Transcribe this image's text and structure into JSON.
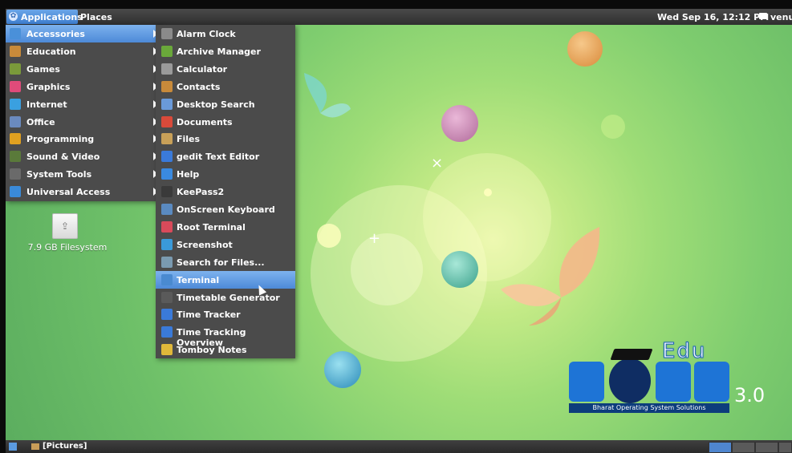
{
  "top_panel": {
    "applications_label": "Applications",
    "places_label": "Places",
    "clock": "Wed Sep 16, 12:12 PM",
    "user": "venu"
  },
  "categories": [
    {
      "label": "Accessories",
      "icon": "accessories-icon",
      "color": "#4a90d9",
      "selected": true
    },
    {
      "label": "Education",
      "icon": "education-icon",
      "color": "#c88a3a"
    },
    {
      "label": "Games",
      "icon": "games-icon",
      "color": "#7a9a3a"
    },
    {
      "label": "Graphics",
      "icon": "graphics-icon",
      "color": "#e04b7a"
    },
    {
      "label": "Internet",
      "icon": "internet-icon",
      "color": "#3aa0e0"
    },
    {
      "label": "Office",
      "icon": "office-icon",
      "color": "#6a8abf"
    },
    {
      "label": "Programming",
      "icon": "programming-icon",
      "color": "#e0a020"
    },
    {
      "label": "Sound & Video",
      "icon": "sound-video-icon",
      "color": "#5a7a3a"
    },
    {
      "label": "System Tools",
      "icon": "system-tools-icon",
      "color": "#6a6a6a"
    },
    {
      "label": "Universal Access",
      "icon": "universal-access-icon",
      "color": "#3a8ad9"
    }
  ],
  "accessories": [
    {
      "label": "Alarm Clock",
      "icon": "alarm-clock-icon",
      "color": "#8a8a8a"
    },
    {
      "label": "Archive Manager",
      "icon": "archive-manager-icon",
      "color": "#6aa83a"
    },
    {
      "label": "Calculator",
      "icon": "calculator-icon",
      "color": "#9a9a9a"
    },
    {
      "label": "Contacts",
      "icon": "contacts-icon",
      "color": "#c88a3a"
    },
    {
      "label": "Desktop Search",
      "icon": "desktop-search-icon",
      "color": "#6a9ad9"
    },
    {
      "label": "Documents",
      "icon": "documents-icon",
      "color": "#d94a3a"
    },
    {
      "label": "Files",
      "icon": "files-icon",
      "color": "#c8a058"
    },
    {
      "label": "gedit Text Editor",
      "icon": "gedit-icon",
      "color": "#3a7ad9"
    },
    {
      "label": "Help",
      "icon": "help-icon",
      "color": "#3a8ae0"
    },
    {
      "label": "KeePass2",
      "icon": "keepass-icon",
      "color": "#3a3a3a"
    },
    {
      "label": "OnScreen Keyboard",
      "icon": "onscreen-keyboard-icon",
      "color": "#5a8ac0"
    },
    {
      "label": "Root Terminal",
      "icon": "root-terminal-icon",
      "color": "#d94a5a"
    },
    {
      "label": "Screenshot",
      "icon": "screenshot-icon",
      "color": "#3a9ad9"
    },
    {
      "label": "Search for Files...",
      "icon": "search-files-icon",
      "color": "#7a9ab0"
    },
    {
      "label": "Terminal",
      "icon": "terminal-icon",
      "color": "#4a8ad0",
      "selected": true
    },
    {
      "label": "Timetable Generator",
      "icon": "timetable-generator-icon",
      "color": "#5a5a5a"
    },
    {
      "label": "Time Tracker",
      "icon": "time-tracker-icon",
      "color": "#3a7ad9"
    },
    {
      "label": "Time Tracking Overview",
      "icon": "time-tracking-overview-icon",
      "color": "#3a7ad9"
    },
    {
      "label": "Tomboy Notes",
      "icon": "tomboy-notes-icon",
      "color": "#e0b83a"
    }
  ],
  "desktop": {
    "drive_label": "7.9 GB Filesystem"
  },
  "logo": {
    "edu": "Edu",
    "version": "3.0",
    "tagline": "Bharat Operating System Solutions"
  },
  "bottom_panel": {
    "task_label": "[Pictures]"
  }
}
